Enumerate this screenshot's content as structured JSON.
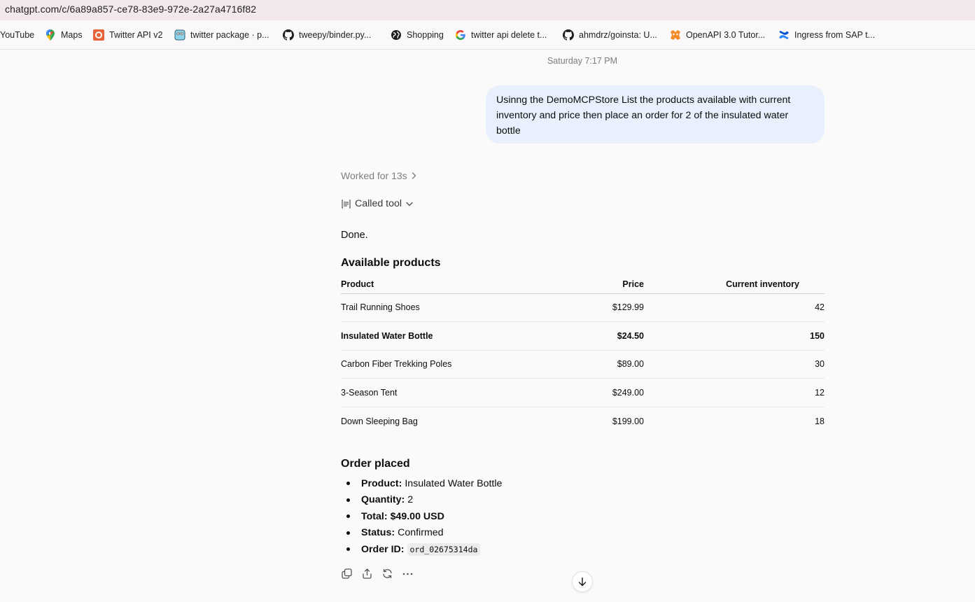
{
  "browser": {
    "url": "chatgpt.com/c/6a89a857-ce78-83e9-972e-2a27a4716f82",
    "bookmarks": [
      {
        "label": "YouTube",
        "icon": "none"
      },
      {
        "label": "Maps",
        "icon": "google-maps-icon"
      },
      {
        "label": "Twitter API v2",
        "icon": "postman-icon"
      },
      {
        "label": "twitter package · p...",
        "icon": "gopher-icon"
      },
      {
        "label": "tweepy/binder.py...",
        "icon": "github-icon"
      },
      {
        "label": "Shopping",
        "icon": "globe-icon"
      },
      {
        "label": "twitter api delete t...",
        "icon": "google-icon"
      },
      {
        "label": "ahmdrz/goinsta: U...",
        "icon": "github-icon"
      },
      {
        "label": "OpenAPI 3.0 Tutor...",
        "icon": "swagger-icon"
      },
      {
        "label": "Ingress from SAP t...",
        "icon": "confluence-icon"
      }
    ]
  },
  "chat": {
    "timestamp": "Saturday 7:17 PM",
    "user_message": "Usinng the DemoMCPStore List the products available with current inventory and price then place an order for 2 of the insulated water bottle",
    "worked_label": "Worked for 13s",
    "called_tool_label": "Called tool",
    "done_text": "Done.",
    "products_heading": "Available products",
    "table": {
      "headers": [
        "Product",
        "Price",
        "Current inventory"
      ],
      "rows": [
        {
          "product": "Trail Running Shoes",
          "price": "$129.99",
          "inventory": "42",
          "bold": false
        },
        {
          "product": "Insulated Water Bottle",
          "price": "$24.50",
          "inventory": "150",
          "bold": true
        },
        {
          "product": "Carbon Fiber Trekking Poles",
          "price": "$89.00",
          "inventory": "30",
          "bold": false
        },
        {
          "product": "3-Season Tent",
          "price": "$249.00",
          "inventory": "12",
          "bold": false
        },
        {
          "product": "Down Sleeping Bag",
          "price": "$199.00",
          "inventory": "18",
          "bold": false
        }
      ]
    },
    "order_heading": "Order placed",
    "order_items": [
      {
        "label": "Product:",
        "value": "Insulated Water Bottle",
        "value_bold": false,
        "code": false
      },
      {
        "label": "Quantity:",
        "value": "2",
        "value_bold": false,
        "code": false
      },
      {
        "label": "Total:",
        "value": "$49.00 USD",
        "value_bold": true,
        "code": false
      },
      {
        "label": "Status:",
        "value": "Confirmed",
        "value_bold": false,
        "code": false
      },
      {
        "label": "Order ID:",
        "value": "ord_02675314da",
        "value_bold": false,
        "code": true
      }
    ],
    "action_icons": [
      "copy-icon",
      "share-icon",
      "regenerate-icon",
      "more-icon"
    ],
    "scroll_icon": "arrow-down-icon"
  }
}
